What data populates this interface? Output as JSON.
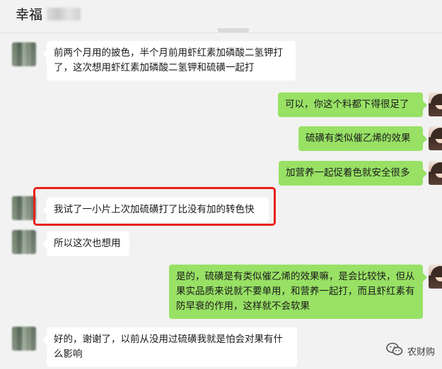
{
  "chat": {
    "contact_name": "幸福",
    "messages": [
      {
        "side": "left",
        "text": "前两个月用的披色，半个月前用虾红素加磷酸二氢钾打了，这次想用虾红素加磷酸二氢钾和硫磺一起打"
      },
      {
        "side": "right",
        "text": "可以，你这个料都下得很足了"
      },
      {
        "side": "right",
        "text": "硫磺有类似催乙烯的效果"
      },
      {
        "side": "right",
        "text": "加营养一起促着色就安全很多"
      },
      {
        "side": "left",
        "text": "我试了一小片上次加硫磺打了比没有加的转色快"
      },
      {
        "side": "left",
        "text": "所以这次也想用"
      },
      {
        "side": "right",
        "text": "是的，硫磺是有类似催乙烯的效果嘛，是会比较快，但从果实品质来说就不要单用，和营养一起打，而且虾红素有防早衰的作用，这样就不会软果"
      },
      {
        "side": "left",
        "text": "好的，谢谢了，以前从没用过硫磺我就是怕会对果有什么影响"
      }
    ]
  },
  "watermark": {
    "text": "农财购",
    "icon": "wechat-icon"
  },
  "colors": {
    "bubble_right": "#98e165",
    "bubble_left": "#ffffff",
    "highlight": "#e8201a",
    "background": "#f2f2f2"
  }
}
